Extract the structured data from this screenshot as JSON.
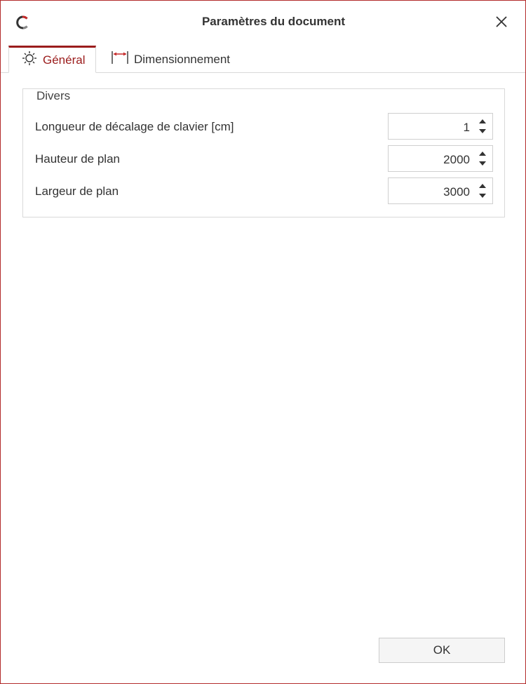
{
  "window": {
    "title": "Paramètres du document",
    "close_icon": "close-icon",
    "app_icon": "app-logo-icon",
    "accent_color": "#9b1c1c",
    "border_color": "#b22b2b"
  },
  "tabs": [
    {
      "label": "Général",
      "icon": "sun-icon",
      "selected": true
    },
    {
      "label": "Dimensionnement",
      "icon": "dimension-arrow-icon",
      "selected": false
    }
  ],
  "group": {
    "legend": "Divers",
    "rows": [
      {
        "label": "Longueur de décalage de clavier [cm]",
        "value": "1"
      },
      {
        "label": "Hauteur de plan",
        "value": "2000"
      },
      {
        "label": "Largeur de plan",
        "value": "3000"
      }
    ]
  },
  "footer": {
    "ok_label": "OK"
  }
}
